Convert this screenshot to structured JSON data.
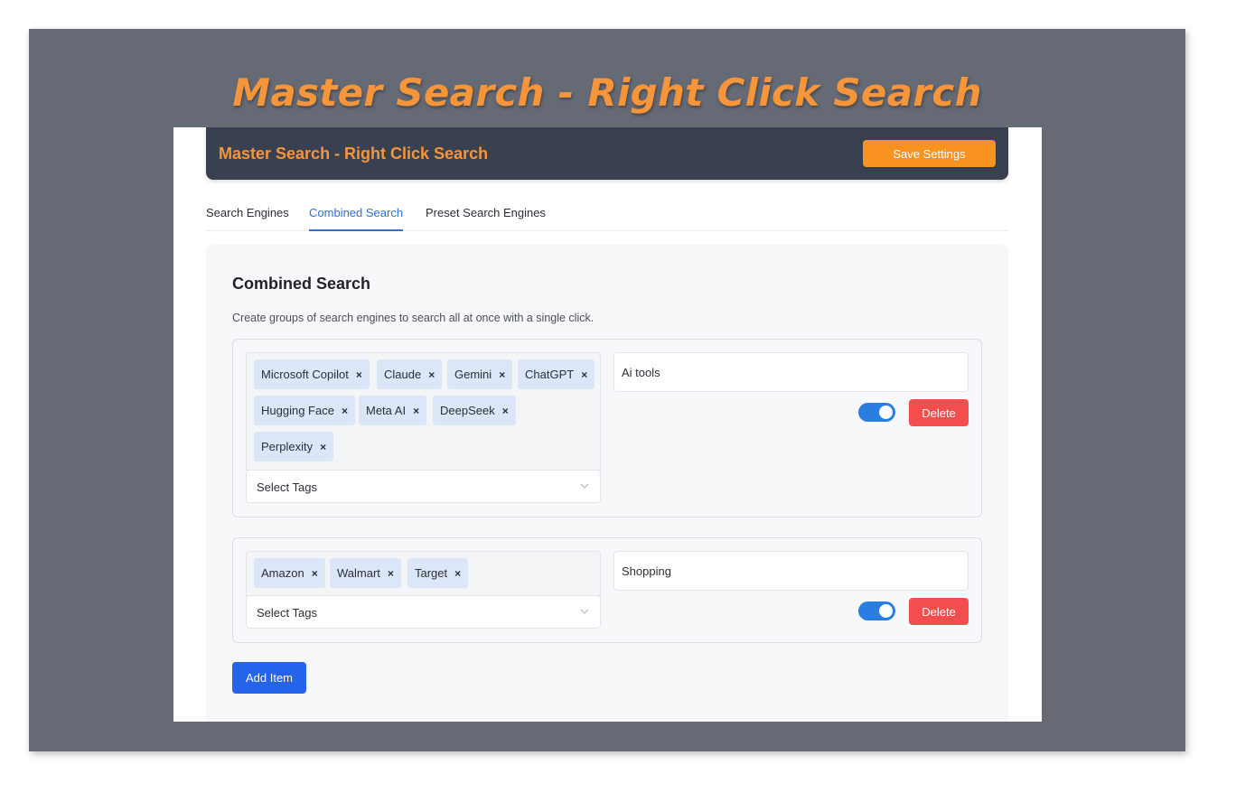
{
  "promo": {
    "title": "Master Search - Right Click Search"
  },
  "header": {
    "title": "Master Search - Right Click Search",
    "save_label": "Save Settings"
  },
  "tabs": [
    {
      "label": "Search Engines",
      "active": false
    },
    {
      "label": "Combined Search",
      "active": true
    },
    {
      "label": "Preset Search Engines",
      "active": false
    }
  ],
  "panel": {
    "title": "Combined Search",
    "description": "Create groups of search engines to search all at once with a single click."
  },
  "groups": [
    {
      "tags": [
        "Microsoft Copilot",
        "Claude",
        "Gemini",
        "ChatGPT",
        "Hugging Face",
        "Meta AI",
        "DeepSeek",
        "Perplexity"
      ],
      "tag_remove_glyph": "×",
      "select_placeholder": "Select Tags",
      "name": "Ai tools",
      "enabled": true,
      "delete_label": "Delete"
    },
    {
      "tags": [
        "Amazon",
        "Walmart",
        "Target"
      ],
      "tag_remove_glyph": "×",
      "select_placeholder": "Select Tags",
      "name": "Shopping",
      "enabled": true,
      "delete_label": "Delete"
    }
  ],
  "add_item_label": "Add Item",
  "colors": {
    "backdrop": "#656a75",
    "accent_orange": "#f7953b",
    "header_bg": "#394150",
    "tab_active": "#2f6fd6",
    "tag_bg": "#dbe6f8",
    "toggle_on": "#2a7de1",
    "delete": "#f44d4d",
    "primary": "#2563eb"
  },
  "icons": {
    "tag_remove": "close-icon",
    "select_arrow": "chevron-down-icon"
  }
}
